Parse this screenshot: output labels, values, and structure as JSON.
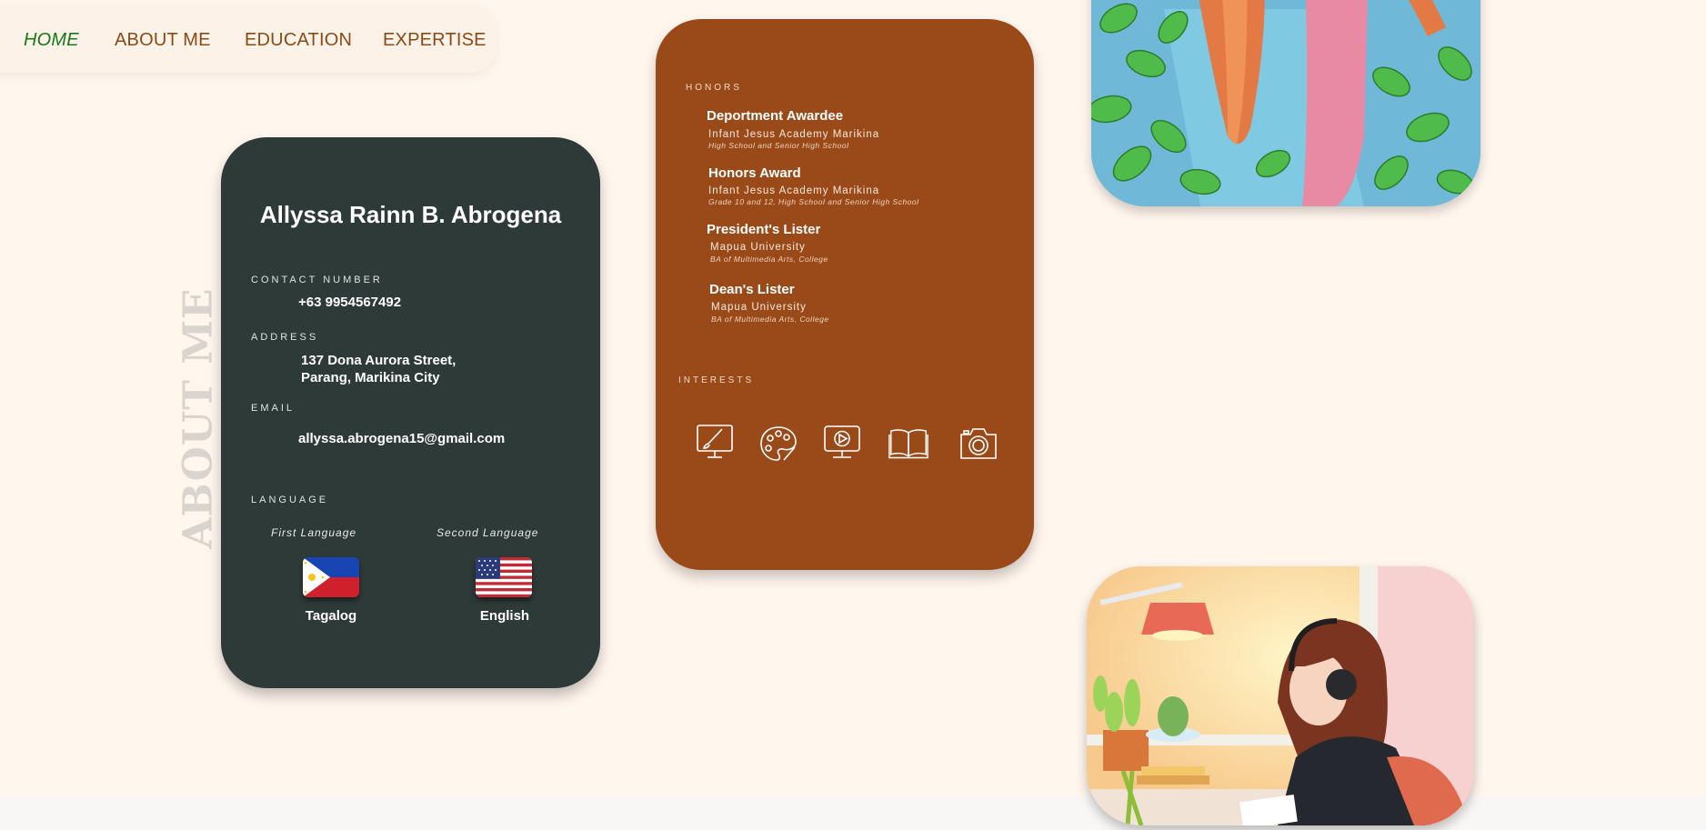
{
  "nav": {
    "items": [
      {
        "label": "HOME",
        "active": true
      },
      {
        "label": "ABOUT ME",
        "active": false
      },
      {
        "label": "EDUCATION",
        "active": false
      },
      {
        "label": "EXPERTISE",
        "active": false
      }
    ]
  },
  "section_title": "ABOUT ME",
  "contact": {
    "name": "Allyssa Rainn B. Abrogena",
    "contact_label": "CONTACT NUMBER",
    "contact_value": "+63 9954567492",
    "address_label": "ADDRESS",
    "address_line1": "137 Dona Aurora Street,",
    "address_line2": "Parang, Marikina City",
    "email_label": "EMAIL",
    "email_value": "allyssa.abrogena15@gmail.com",
    "language_label": "LANGUAGE",
    "languages": [
      {
        "caption": "First Language",
        "name": "Tagalog",
        "flag": "philippines-flag"
      },
      {
        "caption": "Second Language",
        "name": "English",
        "flag": "usa-flag"
      }
    ]
  },
  "honors": {
    "label": "HONORS",
    "items": [
      {
        "title": "Deportment Awardee",
        "school": "Infant Jesus Academy Marikina",
        "note": "High School and Senior High School"
      },
      {
        "title": "Honors Award",
        "school": "Infant Jesus Academy Marikina",
        "note": "Grade 10 and 12, High School and Senior High School"
      },
      {
        "title": "President's Lister",
        "school": "Mapua University",
        "note": "BA of Multimedia Arts, College"
      },
      {
        "title": "Dean's Lister",
        "school": "Mapua University",
        "note": "BA of Multimedia Arts, College"
      }
    ],
    "interests_label": "INTERESTS",
    "interests": [
      "digital-art-icon",
      "painting-palette-icon",
      "video-icon",
      "book-icon",
      "camera-icon"
    ]
  },
  "colors": {
    "background": "#fff6ee",
    "nav_text": "#8a4a16",
    "nav_active": "#157a1a",
    "contact_card": "#2e3a38",
    "honors_card": "#9a4a19"
  }
}
